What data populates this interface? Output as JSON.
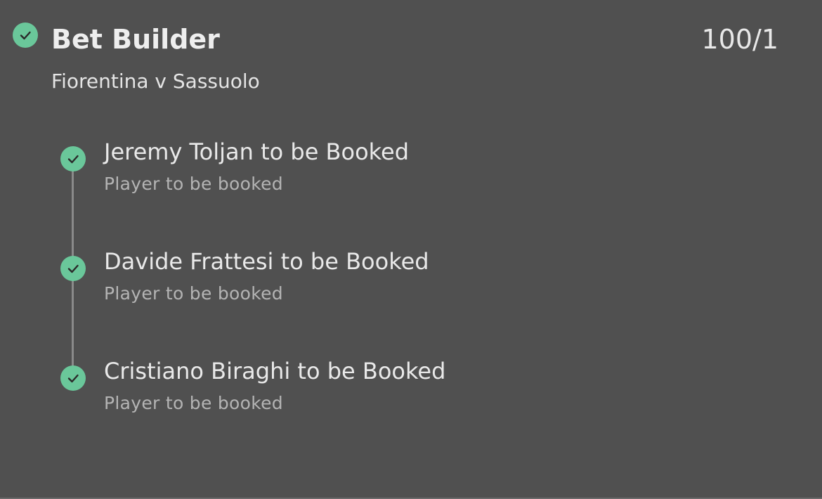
{
  "bet": {
    "title": "Bet Builder",
    "odds": "100/1",
    "event": "Fiorentina v Sassuolo",
    "status_icon": "check-circle-icon",
    "accent_color": "#6ac79a",
    "legs": [
      {
        "title": "Jeremy Toljan to be Booked",
        "market": "Player to be booked"
      },
      {
        "title": "Davide Frattesi to be Booked",
        "market": "Player to be booked"
      },
      {
        "title": "Cristiano Biraghi to be Booked",
        "market": "Player to be booked"
      }
    ]
  }
}
